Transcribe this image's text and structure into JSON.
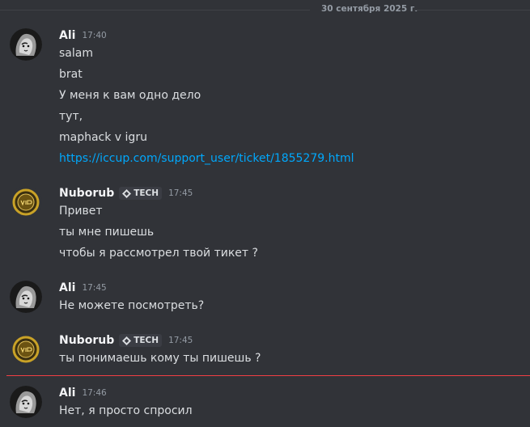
{
  "date_divider": "30 сентября 2025 г.",
  "messages": [
    {
      "author": "Ali",
      "time": "17:40",
      "lines": [
        "salam",
        "brat",
        "У меня к вам одно дело",
        "тут,",
        "maphack v igru"
      ],
      "link": "https://iccup.com/support_user/ticket/1855279.html"
    },
    {
      "author": "Nuborub",
      "tag": "TECH",
      "time": "17:45",
      "lines": [
        "Привет",
        "ты мне пишешь",
        "чтобы я рассмотрел твой тикет ?"
      ]
    },
    {
      "author": "Ali",
      "time": "17:45",
      "lines": [
        "Не можете посмотреть?"
      ]
    },
    {
      "author": "Nuborub",
      "tag": "TECH",
      "time": "17:45",
      "lines": [
        "ты понимаешь кому ты пишешь ?"
      ]
    },
    {
      "author": "Ali",
      "time": "17:46",
      "lines": [
        "Нет, я просто спросил"
      ]
    }
  ],
  "colors": {
    "background": "#313338",
    "link": "#00a8fc",
    "new_messages_line": "#f23f43",
    "vip_gold": "#c9a227"
  },
  "icons": {
    "ali_avatar": "lion-avatar-icon",
    "nuborub_avatar": "vip-badge-avatar-icon",
    "tag": "diamond-tag-icon"
  }
}
